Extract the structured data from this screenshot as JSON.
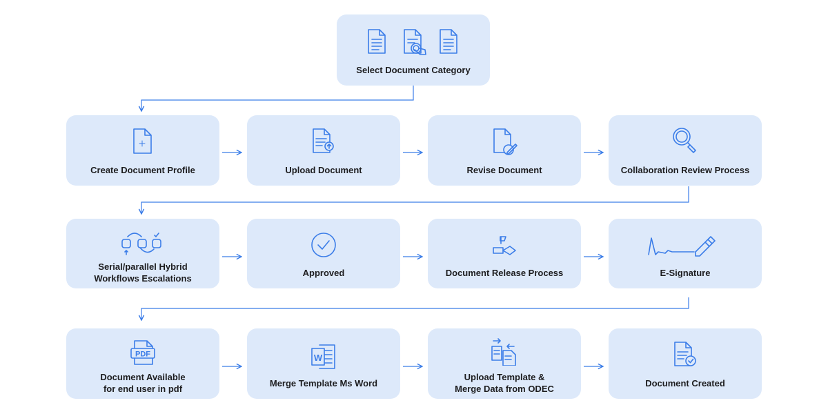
{
  "steps": {
    "select_category": "Select Document Category",
    "create_profile": "Create Document Profile",
    "upload": "Upload Document",
    "revise": "Revise Document",
    "collab_review": "Collaboration Review Process",
    "workflows_1": "Serial/parallel Hybrid",
    "workflows_2": "Workflows Escalations",
    "approved": "Approved",
    "release": "Document Release Process",
    "esignature": "E-Signature",
    "pdf_1": "Document Available",
    "pdf_2": "for end user in pdf",
    "merge_word": "Merge Template Ms Word",
    "odec_1": "Upload Template &",
    "odec_2": "Merge Data from ODEC",
    "created": "Document Created"
  },
  "icons": {
    "pdf_text": "PDF",
    "word_text": "W"
  },
  "colors": {
    "box": "#dde9fa",
    "accent": "#3b7de8"
  }
}
